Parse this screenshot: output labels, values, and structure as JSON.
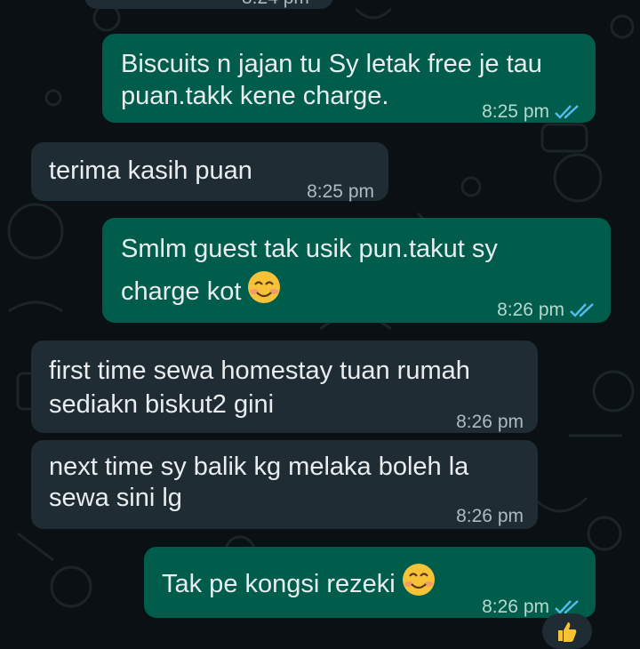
{
  "chat": {
    "top_partial_time": "8:24 pm",
    "messages": [
      {
        "direction": "out",
        "lines": [
          "Biscuits n jajan tu Sy letak free je tau",
          "puan.takk kene charge."
        ],
        "time": "8:25 pm",
        "status": "read"
      },
      {
        "direction": "in",
        "lines": [
          "terima kasih puan"
        ],
        "time": "8:25 pm"
      },
      {
        "direction": "out",
        "lines": [
          "Smlm guest tak usik pun.takut sy",
          "charge kot"
        ],
        "emoji": "smiling-face-with-smiling-eyes",
        "time": "8:26 pm",
        "status": "read"
      },
      {
        "direction": "in",
        "lines": [
          "first time sewa homestay tuan rumah",
          "sediakn biskut2 gini"
        ],
        "time": "8:26 pm"
      },
      {
        "direction": "in",
        "lines": [
          "next time sy balik kg melaka boleh la",
          "sewa sini lg"
        ],
        "time": "8:26 pm"
      },
      {
        "direction": "out",
        "lines": [
          "Tak pe kongsi rezeki"
        ],
        "emoji": "smiling-face",
        "time": "8:26 pm",
        "status": "read"
      }
    ],
    "reaction_icon": "thumbs-up-icon"
  },
  "colors": {
    "background": "#0b1014",
    "outgoing_bubble": "#005c4b",
    "incoming_bubble": "#1f2c33",
    "text": "#e9edef",
    "read_ticks": "#53bdeb"
  }
}
